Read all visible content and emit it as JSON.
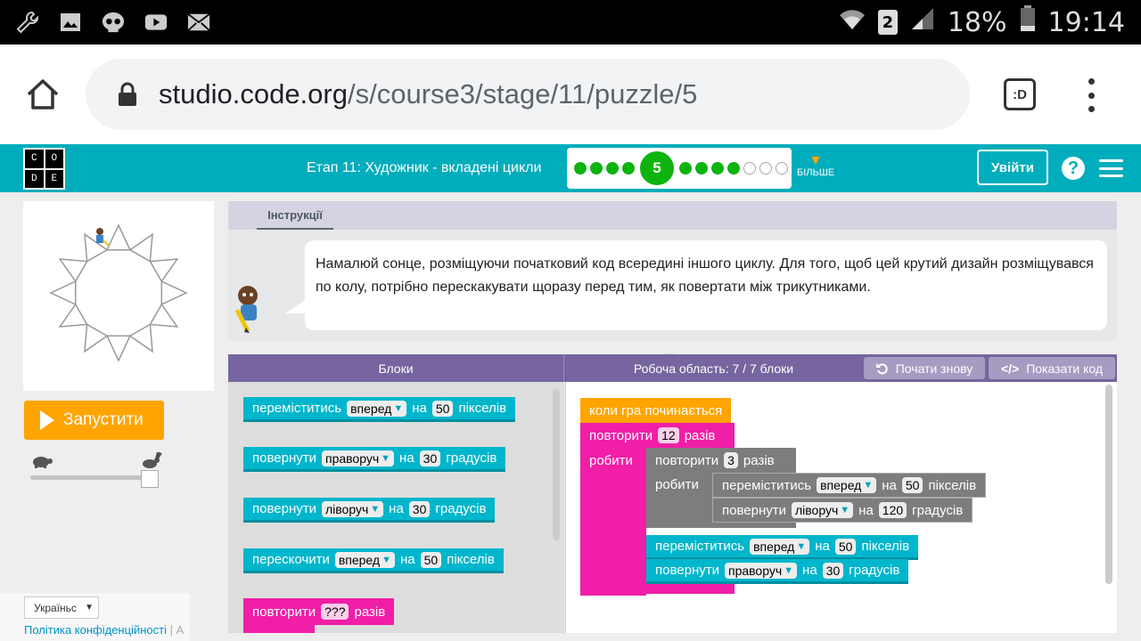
{
  "status_bar": {
    "battery": "18%",
    "time": "19:14",
    "sim": "2",
    "icons": [
      "wrench-icon",
      "image-icon",
      "skull-icon",
      "youtube-icon",
      "mail-icon",
      "wifi-icon",
      "signal-icon",
      "battery-icon"
    ]
  },
  "browser": {
    "url_host": "studio.code.org",
    "url_path": "/s/course3/stage/11/puzzle/5",
    "tab_label": ":D"
  },
  "header": {
    "logo_letters": [
      "C",
      "O",
      "D",
      "E"
    ],
    "stage_title": "Етап 11: Художник - вкладені цикли",
    "current_puzzle": "5",
    "more_label": "БІЛЬШЕ",
    "signin_label": "Увійти",
    "help_label": "?",
    "progress_completed_before": 4,
    "progress_completed_after": 4,
    "progress_empty": 3
  },
  "left": {
    "run_label": "Запустити",
    "speed_level": 1.0,
    "language": "Україньс",
    "privacy_link": "Політика конфіденційності",
    "privacy_suffix": "А"
  },
  "instructions": {
    "tab_label": "Інструкції",
    "text": "Намалюй сонце, розміщуючи початковий код всередині іншого циклу. Для того, щоб цей крутий дизайн розміщувався по колу, потрібно перескакувати щоразу перед тим, як повертати між трикутниками."
  },
  "workspace_header": {
    "blocks_label": "Блоки",
    "workspace_label": "Робоча область: 7 / 7 блоки",
    "restart_label": "Почати знову",
    "show_code_label": "Показати код"
  },
  "toolbox": {
    "b1": {
      "verb": "переміститись",
      "dir": "вперед",
      "on": "на",
      "val": "50",
      "unit": "пікселів"
    },
    "b2": {
      "verb": "повернути",
      "dir": "праворуч",
      "on": "на",
      "val": "30",
      "unit": "градусів"
    },
    "b3": {
      "verb": "повернути",
      "dir": "ліворуч",
      "on": "на",
      "val": "30",
      "unit": "градусів"
    },
    "b4": {
      "verb": "перескочити",
      "dir": "вперед",
      "on": "на",
      "val": "50",
      "unit": "пікселів"
    },
    "b5": {
      "verb": "повторити",
      "val": "???",
      "unit": "разів"
    }
  },
  "program": {
    "when_run": "коли гра починається",
    "outer_repeat": {
      "verb": "повторити",
      "val": "12",
      "unit": "разів",
      "do": "робити"
    },
    "inner_repeat": {
      "verb": "повторити",
      "val": "3",
      "unit": "разів",
      "do": "робити"
    },
    "inner_move": {
      "verb": "переміститись",
      "dir": "вперед",
      "on": "на",
      "val": "50",
      "unit": "пікселів"
    },
    "inner_turn": {
      "verb": "повернути",
      "dir": "ліворуч",
      "on": "на",
      "val": "120",
      "unit": "градусів"
    },
    "outer_move": {
      "verb": "переміститись",
      "dir": "вперед",
      "on": "на",
      "val": "50",
      "unit": "пікселів"
    },
    "outer_turn": {
      "verb": "повернути",
      "dir": "праворуч",
      "on": "на",
      "val": "30",
      "unit": "градусів"
    }
  },
  "colors": {
    "teal": "#00adbc",
    "run_orange": "#ffa400",
    "progress_green": "#0eb40e",
    "repeat_pink": "#f11ea7",
    "header_purple": "#7665a0"
  }
}
